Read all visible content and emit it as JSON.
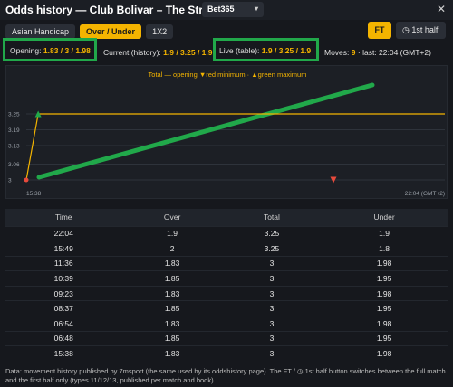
{
  "header": {
    "title": "Odds history — Club Bolivar – The Strongest",
    "bookmaker": "Bet365",
    "chevron": "▾",
    "close": "✕"
  },
  "tabs": [
    {
      "label": "Asian Handicap"
    },
    {
      "label": "Over / Under"
    },
    {
      "label": "1X2"
    }
  ],
  "period": {
    "ft_label": "FT",
    "half_icon": "◷",
    "half_label": "1st half"
  },
  "infobar": {
    "opening_label": "Opening:",
    "opening_value": "1.83 / 3 / 1.98",
    "current_label": "Current (history):",
    "current_value": "1.9 / 3.25 / 1.9",
    "live_label": "Live (table):",
    "live_value": "1.9 / 3.25 / 1.9",
    "moves_label": "Moves:",
    "moves_count": "9",
    "moves_last": "· last: 22:04 (GMT+2)"
  },
  "chart_data": {
    "type": "line",
    "legend": "Total — opening ▼red minimum · ▲green maximum",
    "y_ticks": [
      "3.25",
      "3.19",
      "3.13",
      "3.06",
      "3"
    ],
    "ylim": [
      3,
      3.25
    ],
    "x_start_label": "15:38",
    "x_end_label": "22:04 (GMT+2)",
    "series": [
      {
        "values": [
          {
            "time": "15:38",
            "total": 3
          },
          {
            "time": "15:49",
            "total": 3.25
          },
          {
            "time": "22:04",
            "total": 3.25
          }
        ]
      }
    ],
    "colors": {
      "line": "#f4b400",
      "opening": "#e84a3c",
      "minimum": "#e84a3c",
      "maximum": "#21a84a"
    }
  },
  "table": {
    "columns": [
      "Time",
      "Over",
      "Total",
      "Under"
    ],
    "rows": [
      [
        "22:04",
        "1.9",
        "3.25",
        "1.9"
      ],
      [
        "15:49",
        "2",
        "3.25",
        "1.8"
      ],
      [
        "11:36",
        "1.83",
        "3",
        "1.98"
      ],
      [
        "10:39",
        "1.85",
        "3",
        "1.95"
      ],
      [
        "09:23",
        "1.83",
        "3",
        "1.98"
      ],
      [
        "08:37",
        "1.85",
        "3",
        "1.95"
      ],
      [
        "06:54",
        "1.83",
        "3",
        "1.98"
      ],
      [
        "06:48",
        "1.85",
        "3",
        "1.95"
      ],
      [
        "15:38",
        "1.83",
        "3",
        "1.98"
      ]
    ]
  },
  "footer": {
    "text": "Data: movement history published by 7msport (the same used by its oddshistory page). The FT / ◷ 1st half button switches between the full match and the first half only (types 11/12/13, published per match and book)."
  },
  "colors": {
    "accent": "#f4b400",
    "highlight_box": "#21a84a",
    "background": "#16181d"
  }
}
